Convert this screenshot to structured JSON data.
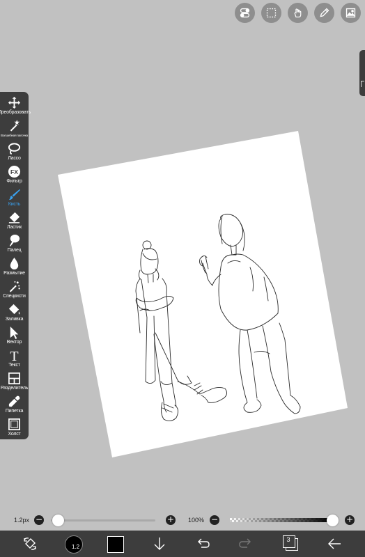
{
  "top_buttons": [
    {
      "icon": "toggle-icon"
    },
    {
      "icon": "selection-icon"
    },
    {
      "icon": "hand-icon"
    },
    {
      "icon": "pencil-icon"
    },
    {
      "icon": "image-icon"
    }
  ],
  "tools": [
    {
      "label": "Преобразовать",
      "icon": "move-icon",
      "active": false
    },
    {
      "label": "Волшебная палочка",
      "icon": "magic-wand-icon",
      "active": false
    },
    {
      "label": "Лассо",
      "icon": "lasso-icon",
      "active": false
    },
    {
      "label": "Фильтр",
      "icon": "fx-icon",
      "active": false
    },
    {
      "label": "Кисть",
      "icon": "brush-icon",
      "active": true
    },
    {
      "label": "Ластик",
      "icon": "eraser-icon",
      "active": false
    },
    {
      "label": "Палец",
      "icon": "finger-icon",
      "active": false
    },
    {
      "label": "Размытие",
      "icon": "blur-drop-icon",
      "active": false
    },
    {
      "label": "Спецкисти",
      "icon": "special-brush-icon",
      "active": false
    },
    {
      "label": "Заливка",
      "icon": "fill-bucket-icon",
      "active": false
    },
    {
      "label": "Вектор",
      "icon": "vector-arrow-icon",
      "active": false
    },
    {
      "label": "Текст",
      "icon": "text-icon",
      "active": false
    },
    {
      "label": "Разделитель",
      "icon": "frame-divider-icon",
      "active": false
    },
    {
      "label": "Пипетка",
      "icon": "eyedropper-icon",
      "active": false
    },
    {
      "label": "Холст",
      "icon": "canvas-icon",
      "active": false
    }
  ],
  "brush_size": {
    "label": "1.2px",
    "value_fraction": 0.02
  },
  "opacity": {
    "label": "100%",
    "value_fraction": 1.0
  },
  "bottom_bar": {
    "brush_preview_label": "1.2",
    "color": "#000000",
    "layers_count": "3"
  },
  "colors": {
    "background": "#c1c1c1",
    "panel": "#3d3d3d",
    "accent": "#3aa2f0"
  }
}
